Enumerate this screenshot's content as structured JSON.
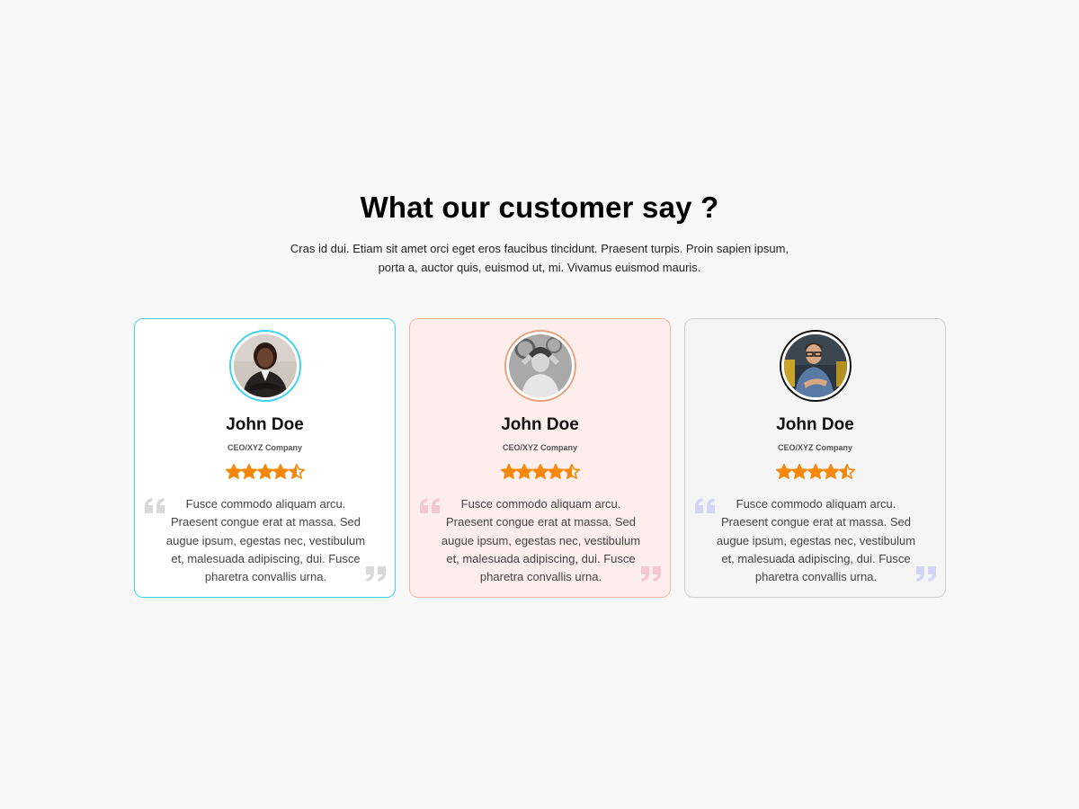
{
  "heading": "What our customer say ?",
  "subtitle": "Cras id dui. Etiam sit amet orci eget eros faucibus tincidunt. Praesent turpis. Proin sapien ipsum, porta a, auctor quis, euismod ut, mi. Vivamus euismod mauris.",
  "star_color": "#f5880a",
  "testimonials": [
    {
      "name": "John Doe",
      "role": "CEO/XYZ Company",
      "rating": 4.5,
      "text": "Fusce commodo aliquam arcu. Praesent congue erat at massa. Sed augue ipsum, egestas nec, vestibulum et, malesuada adipiscing, dui. Fusce pharetra convallis urna.",
      "accent": "#3ed3ef",
      "quote_color": "#d9d9d9"
    },
    {
      "name": "John Doe",
      "role": "CEO/XYZ Company",
      "rating": 4.5,
      "text": "Fusce commodo aliquam arcu. Praesent congue erat at massa. Sed augue ipsum, egestas nec, vestibulum et, malesuada adipiscing, dui. Fusce pharetra convallis urna.",
      "accent": "#efb9a4",
      "quote_color": "#f3c9cf"
    },
    {
      "name": "John Doe",
      "role": "CEO/XYZ Company",
      "rating": 4.5,
      "text": "Fusce commodo aliquam arcu. Praesent congue erat at massa. Sed augue ipsum, egestas nec, vestibulum et, malesuada adipiscing, dui. Fusce pharetra convallis urna.",
      "accent": "#cfcfcf",
      "quote_color": "#d3d5f7"
    }
  ]
}
